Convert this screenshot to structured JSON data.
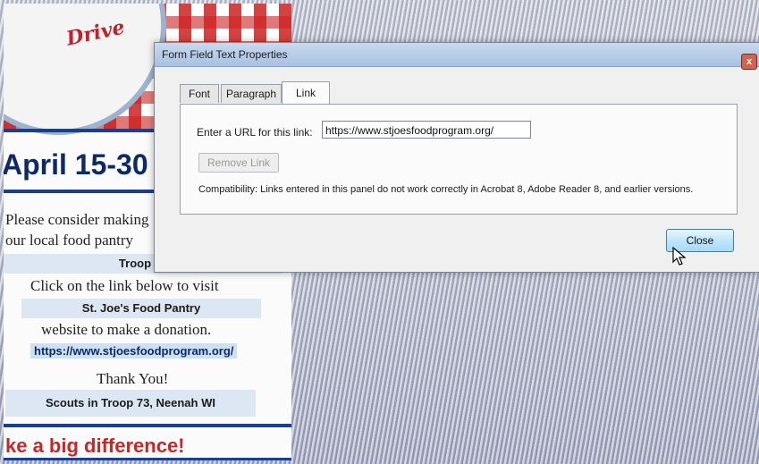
{
  "document": {
    "logo_script": "Drive",
    "heading": "April 15-30",
    "lines": [
      "Please consider making",
      "our local food pantry"
    ],
    "troop_box": "Troop 73",
    "visit_line": "Click on the link below to visit",
    "pantry_box": "St. Joe's Food Pantry",
    "donation_line": "website to make a donation.",
    "link_text": "https://www.stjoesfoodprogram.org/",
    "thank_you": "Thank You!",
    "scouts_box": "Scouts in Troop 73, Neenah WI",
    "bottom_text": "ke a big difference!"
  },
  "dialog": {
    "title": "Form Field Text Properties",
    "close_glyph": "x",
    "tabs": [
      {
        "label": "Font",
        "active": false
      },
      {
        "label": "Paragraph",
        "active": false
      },
      {
        "label": "Link",
        "active": true
      }
    ],
    "url_label": "Enter a URL for this link:",
    "url_value": "https://www.stjoesfoodprogram.org/",
    "remove_link_label": "Remove Link",
    "compatibility_text": "Compatibility: Links entered in this panel do not work correctly in Acrobat 8, Adobe Reader 8, and earlier versions.",
    "close_button_label": "Close"
  },
  "colors": {
    "title_bar": "#a8c1e2",
    "close_button": "#bee6fd",
    "doc_heading": "#0e2a66",
    "doc_accent_red": "#c62828"
  },
  "icons": [
    "close-icon",
    "mouse-pointer-icon"
  ]
}
